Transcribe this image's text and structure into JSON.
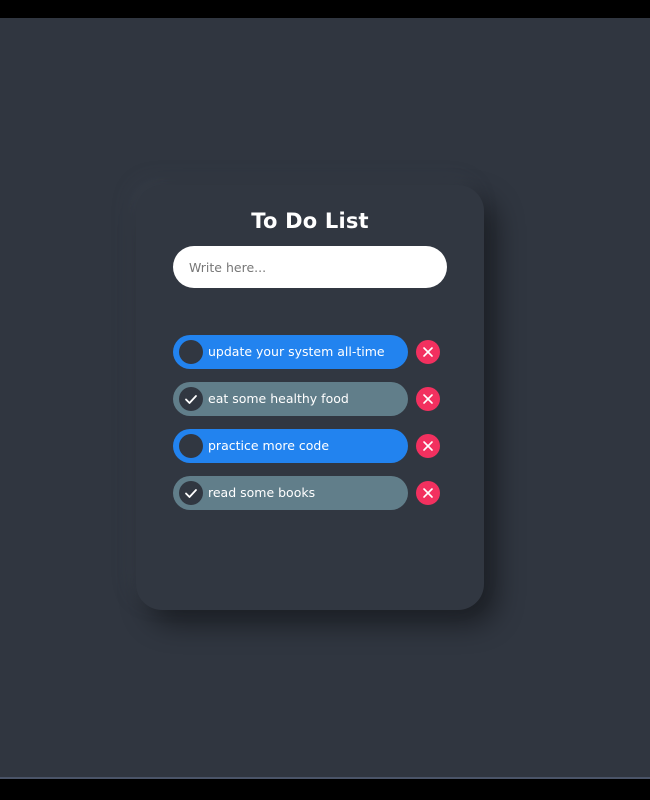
{
  "app": {
    "title": "To Do List"
  },
  "input": {
    "placeholder": "Write here...",
    "value": ""
  },
  "tasks": [
    {
      "label": "update your system all-time",
      "done": false
    },
    {
      "label": "eat some healthy food",
      "done": true
    },
    {
      "label": "practice more code",
      "done": false
    },
    {
      "label": "read some books",
      "done": true
    }
  ],
  "icons": {
    "toggle_unchecked": "circle-icon",
    "toggle_checked": "check-icon",
    "delete": "close-icon"
  },
  "colors": {
    "page_background": "#303640",
    "card_background": "#313741",
    "task_active": "#2283ef",
    "task_done": "#617e8a",
    "delete_button": "#f2305f",
    "text": "#ffffff"
  }
}
